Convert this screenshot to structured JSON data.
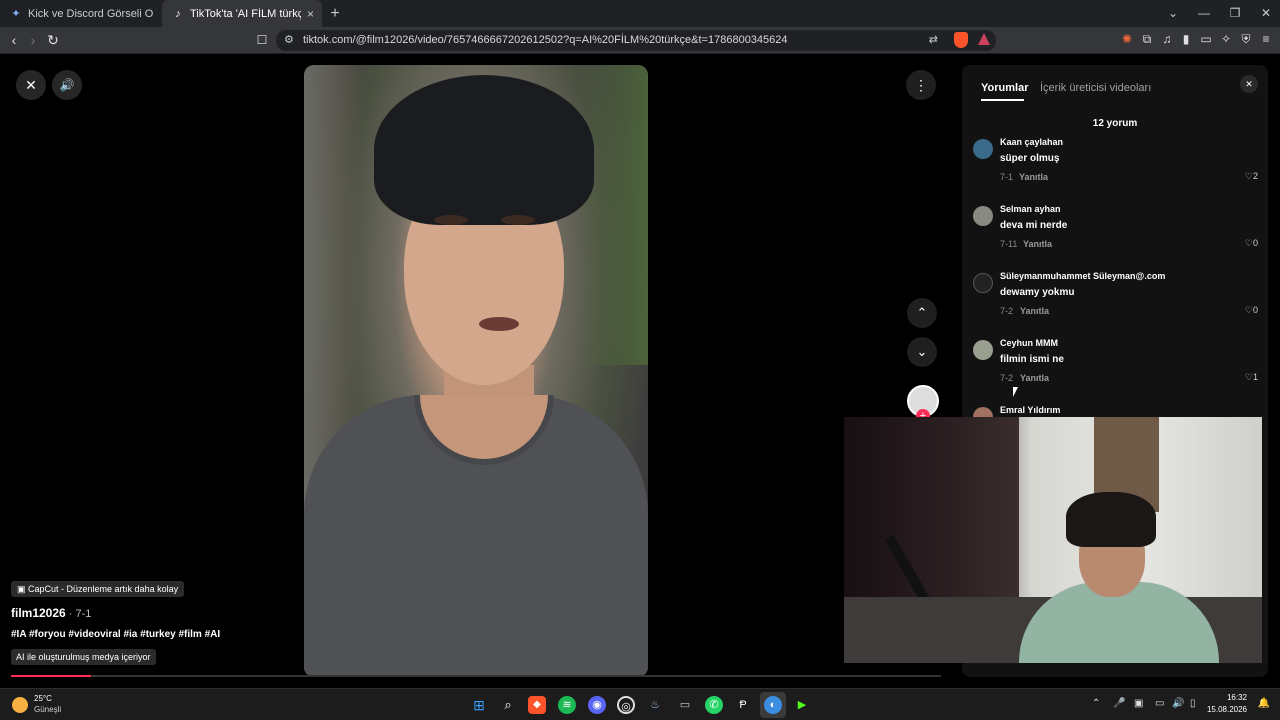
{
  "tabs": [
    {
      "title": "Kick ve Discord Görseli Oluşturma - ",
      "icon": "gemini-sparkle-icon"
    },
    {
      "title": "TikTok'ta 'AI FİLM türkçe' bul",
      "icon": "tiktok-icon",
      "close": "×"
    }
  ],
  "new_tab": "+",
  "window_controls": {
    "list": "⌄",
    "minimize": "—",
    "restore": "❐",
    "close": "✕"
  },
  "address": {
    "url": "tiktok.com/@film12026/video/7657466667202612502?q=AI%20FİLM%20türkçe&t=1786800345624"
  },
  "video": {
    "close": "✕",
    "volume": "🔊",
    "more": "⋮",
    "prev": "⌃",
    "next": "⌄",
    "capcut": "CapCut - Düzenleme artık daha kolay",
    "author": "film12026",
    "date": " · 7-1",
    "tags": "#IA #foryou #videoviral #ia #turkey #film #AI",
    "ai_label": "AI ile oluşturulmuş medya içeriyor",
    "progress": 0.086,
    "follow": "+"
  },
  "comments_panel": {
    "tab_comments": "Yorumlar",
    "tab_creator": "İçerik üreticisi videoları",
    "close": "✕",
    "count": "12 yorum",
    "reply_label": "Yanıtla",
    "comments": [
      {
        "user": "Kaan çaylahan",
        "text": "süper olmuş",
        "date": "7-1",
        "likes": "♡2"
      },
      {
        "user": "Selman ayhan",
        "text": "deva mi nerde",
        "date": "7-11",
        "likes": "♡0"
      },
      {
        "user": "Süleymanmuhammet Süleyman@.com",
        "text": "dewamy yokmu",
        "date": "7-2",
        "likes": "♡0"
      },
      {
        "user": "Ceyhun MMM",
        "text": "filmin ismi ne",
        "date": "7-2",
        "likes": "♡1"
      },
      {
        "user": "Emral Yıldırım",
        "text": "",
        "date": "",
        "likes": ""
      }
    ]
  },
  "taskbar": {
    "temperature": "25°C",
    "weather": "Güneşli",
    "time": "16:32",
    "date": "15.08.2026"
  }
}
